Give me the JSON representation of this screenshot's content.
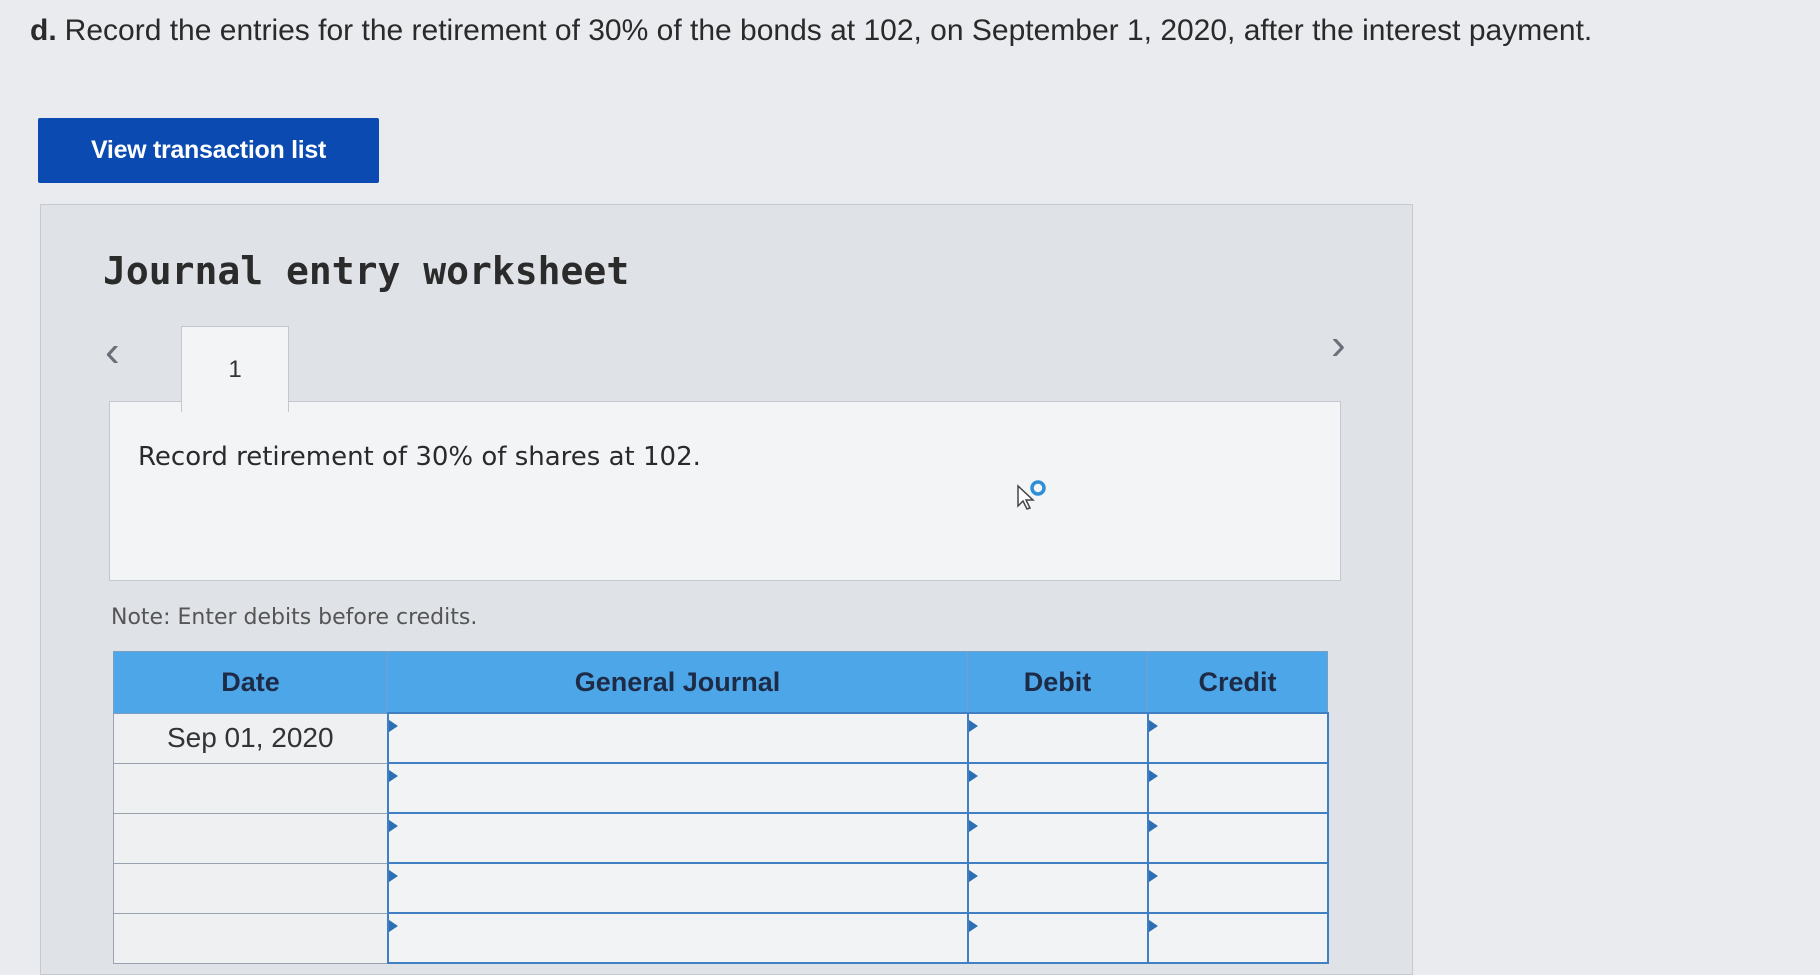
{
  "question": {
    "part": "d.",
    "text": "Record the entries for the retirement of 30% of the bonds at 102, on September 1, 2020, after the interest payment."
  },
  "view_button_label": "View transaction list",
  "worksheet": {
    "title": "Journal entry worksheet",
    "prev_icon": "chevron-left-icon",
    "next_icon": "chevron-right-icon",
    "tabs": [
      {
        "label": "1"
      }
    ],
    "instruction": "Record retirement of 30% of shares at 102.",
    "note": "Note: Enter debits before credits.",
    "table": {
      "headers": {
        "date": "Date",
        "journal": "General Journal",
        "debit": "Debit",
        "credit": "Credit"
      },
      "rows": [
        {
          "date": "Sep 01, 2020",
          "account": "",
          "debit": "",
          "credit": ""
        },
        {
          "date": "",
          "account": "",
          "debit": "",
          "credit": ""
        },
        {
          "date": "",
          "account": "",
          "debit": "",
          "credit": ""
        },
        {
          "date": "",
          "account": "",
          "debit": "",
          "credit": ""
        },
        {
          "date": "",
          "account": "",
          "debit": "",
          "credit": ""
        }
      ]
    }
  },
  "colors": {
    "button": "#0a4ab1",
    "header": "#4da6e8",
    "input_border": "#3f7fc2"
  }
}
